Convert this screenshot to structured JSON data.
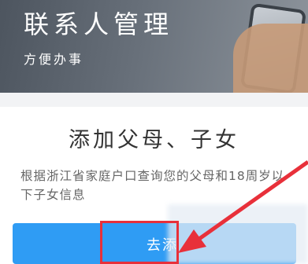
{
  "banner": {
    "title": "联系人管理",
    "subtitle": "方便办事"
  },
  "card": {
    "title": "添加父母、子女",
    "description": "根据浙江省家庭户口查询您的父母和18周岁以下子女信息"
  },
  "action_button": {
    "label": "去添"
  },
  "colors": {
    "button": "#2f9cf4",
    "highlight": "#e8303a"
  }
}
